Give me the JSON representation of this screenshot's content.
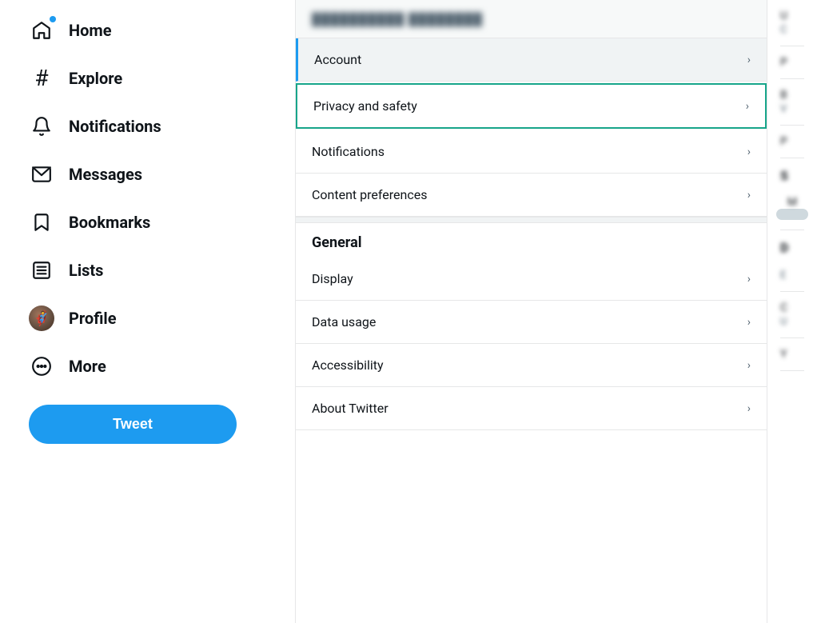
{
  "sidebar": {
    "nav_items": [
      {
        "id": "home",
        "label": "Home",
        "icon": "home"
      },
      {
        "id": "explore",
        "label": "Explore",
        "icon": "explore"
      },
      {
        "id": "notifications",
        "label": "Notifications",
        "icon": "bell"
      },
      {
        "id": "messages",
        "label": "Messages",
        "icon": "envelope"
      },
      {
        "id": "bookmarks",
        "label": "Bookmarks",
        "icon": "bookmark"
      },
      {
        "id": "lists",
        "label": "Lists",
        "icon": "lists"
      },
      {
        "id": "profile",
        "label": "Profile",
        "icon": "profile"
      },
      {
        "id": "more",
        "label": "More",
        "icon": "more"
      }
    ],
    "tweet_button_label": "Tweet"
  },
  "middle": {
    "user_header": "██████████ ████████",
    "settings_items": [
      {
        "id": "account",
        "label": "Account",
        "active": true
      },
      {
        "id": "privacy_safety",
        "label": "Privacy and safety",
        "highlighted": true
      },
      {
        "id": "notifications",
        "label": "Notifications"
      },
      {
        "id": "content_preferences",
        "label": "Content preferences"
      }
    ],
    "general_section": {
      "header": "General",
      "items": [
        {
          "id": "display",
          "label": "Display"
        },
        {
          "id": "data_usage",
          "label": "Data usage"
        },
        {
          "id": "accessibility",
          "label": "Accessibility"
        },
        {
          "id": "about_twitter",
          "label": "About Twitter"
        }
      ]
    }
  },
  "right_panel": {
    "items_top": [
      {
        "text": "U",
        "sub": "C"
      },
      {
        "text": "P"
      },
      {
        "text": "B",
        "sub": "V"
      },
      {
        "text": "P"
      }
    ],
    "section1_header": "S",
    "section1_sub": "",
    "items_mid": [
      {
        "text": "M"
      }
    ],
    "section2_header": "D",
    "section2_sub": "E",
    "items_bot": [
      {
        "text": "C",
        "sub": "U"
      },
      {
        "text": "Y"
      }
    ]
  },
  "chevron": "›",
  "colors": {
    "accent_blue": "#1d9bf0",
    "accent_green": "#17a58a",
    "border": "#e6e7e8",
    "text_primary": "#0f1419",
    "text_secondary": "#536471"
  }
}
